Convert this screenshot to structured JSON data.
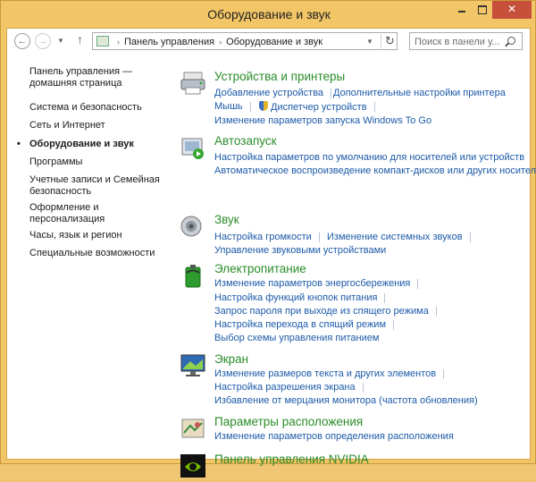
{
  "window": {
    "title": "Оборудование и звук",
    "close_glyph": "✕"
  },
  "nav": {
    "back_glyph": "←",
    "forward_glyph": "→",
    "up_glyph": "↑",
    "address": [
      "Панель управления",
      "Оборудование и звук"
    ],
    "separator": "›",
    "refresh_glyph": "↻",
    "search_placeholder": "Поиск в панели у..."
  },
  "sidebar": {
    "items": [
      {
        "label": "Панель управления — домашняя страница"
      },
      {
        "label": "Система и безопасность"
      },
      {
        "label": "Сеть и Интернет"
      },
      {
        "label": "Оборудование и звук"
      },
      {
        "label": "Программы"
      },
      {
        "label": "Учетные записи и Семейная безопасность"
      },
      {
        "label": "Оформление и персонализация"
      },
      {
        "label": "Часы, язык и регион"
      },
      {
        "label": "Специальные возможности"
      }
    ]
  },
  "categories": [
    {
      "title": "Устройства и принтеры",
      "icon": "devices-printers-icon",
      "links": [
        "Добавление устройства",
        "Дополнительные настройки принтера",
        "Мышь",
        "Диспетчер устройств",
        "Изменение параметров запуска Windows To Go"
      ]
    },
    {
      "title": "Автозапуск",
      "icon": "autoplay-icon",
      "links": [
        "Настройка параметров по умолчанию для носителей или устройств",
        "Автоматическое воспроизведение компакт-дисков или других носителей"
      ]
    },
    {
      "title": "Звук",
      "icon": "speaker-icon",
      "links": [
        "Настройка громкости",
        "Изменение системных звуков",
        "Управление звуковыми устройствами"
      ]
    },
    {
      "title": "Электропитание",
      "icon": "battery-icon",
      "links": [
        "Изменение параметров энергосбережения",
        "Настройка функций кнопок питания",
        "Запрос пароля при выходе из спящего режима",
        "Настройка перехода в спящий режим",
        "Выбор схемы управления питанием"
      ]
    },
    {
      "title": "Экран",
      "icon": "monitor-icon",
      "links": [
        "Изменение размеров текста и других элементов",
        "Настройка разрешения экрана",
        "Избавление от мерцания монитора (частота обновления)"
      ]
    },
    {
      "title": "Параметры расположения",
      "icon": "location-icon",
      "links": [
        "Изменение параметров определения расположения"
      ]
    },
    {
      "title": "Панель управления NVIDIA",
      "icon": "nvidia-icon",
      "links": []
    }
  ]
}
